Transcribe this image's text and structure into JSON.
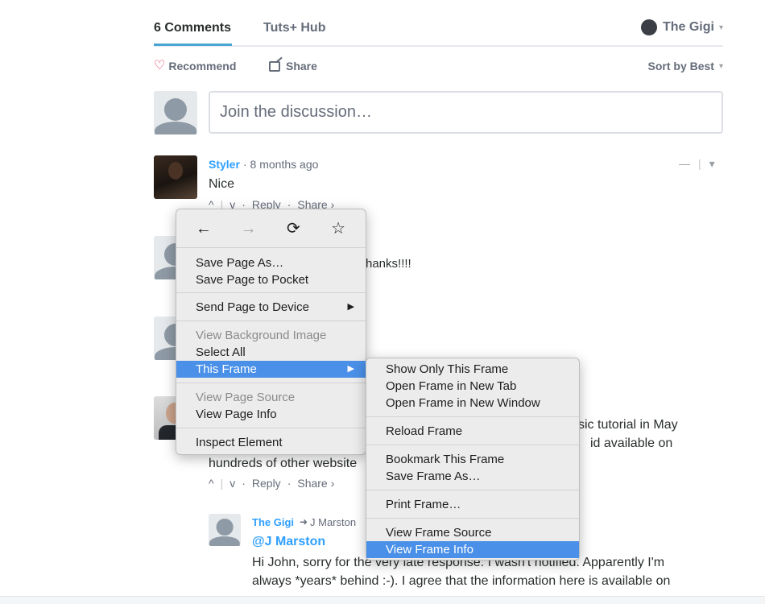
{
  "header": {
    "tab_comments": "6 Comments",
    "tab_hub": "Tuts+ Hub",
    "user_name": "The Gigi",
    "recommend": "Recommend",
    "share": "Share",
    "sort": "Sort by Best",
    "caret": "▾"
  },
  "composer": {
    "placeholder": "Join the discussion…"
  },
  "comments": [
    {
      "author": "Styler",
      "time": "· 8 months ago",
      "body": "Nice",
      "reply": "Reply",
      "share": "Share ›"
    },
    {
      "body_fragment": "hanks!!!!"
    },
    {
      "body_right_1": "sic tutorial in May",
      "body_right_2": "id available on",
      "body_line3": "hundreds of other website",
      "reply": "Reply",
      "share": "Share ›"
    },
    {
      "author": "The Gigi",
      "reply_to": "J Marston",
      "mention": "@J Marston",
      "line1": "Hi John, sorry for the very late response. I wasn't notified. Apparently I'm",
      "line2": "always *years* behind :-). I agree that the information here is available on"
    }
  ],
  "vote_up": "^",
  "vote_down": "v",
  "collapse": "—",
  "context_menu": {
    "nav": {
      "back": "←",
      "forward": "→",
      "reload": "⟳",
      "bookmark": "☆"
    },
    "items": {
      "save_page_as": "Save Page As…",
      "save_to_pocket": "Save Page to Pocket",
      "send_to_device": "Send Page to Device",
      "view_bg_image": "View Background Image",
      "select_all": "Select All",
      "this_frame": "This Frame",
      "view_page_source": "View Page Source",
      "view_page_info": "View Page Info",
      "inspect_element": "Inspect Element"
    },
    "submenu_arrow": "▶"
  },
  "frame_submenu": {
    "show_only": "Show Only This Frame",
    "open_new_tab": "Open Frame in New Tab",
    "open_new_window": "Open Frame in New Window",
    "reload": "Reload Frame",
    "bookmark": "Bookmark This Frame",
    "save_as": "Save Frame As…",
    "print": "Print Frame…",
    "view_source": "View Frame Source",
    "view_info": "View Frame Info"
  }
}
